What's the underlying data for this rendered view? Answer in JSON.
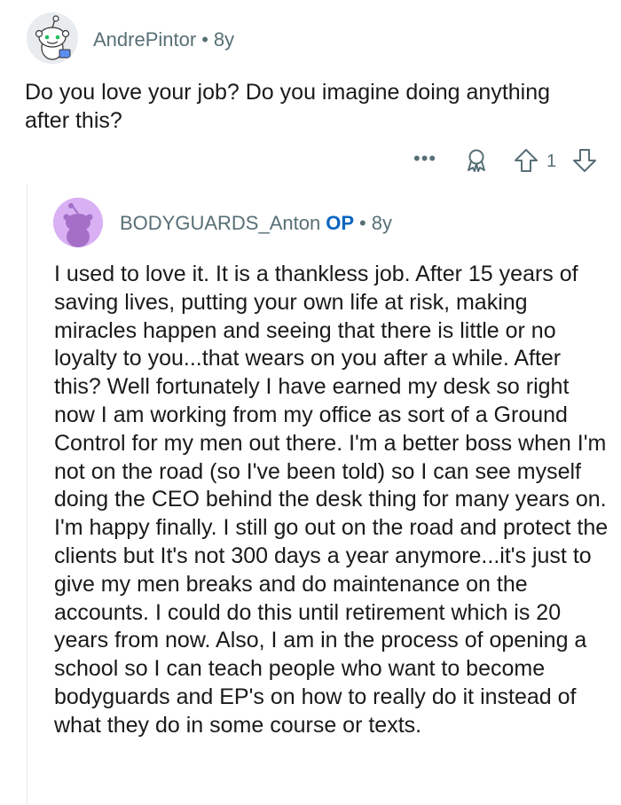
{
  "comment1": {
    "username": "AndrePintor",
    "separator": "•",
    "age": "8y",
    "text": "Do you love your job?  Do you imagine doing anything after this?",
    "actions": {
      "more_icon": "ellipsis-icon",
      "award_icon": "award-icon",
      "upvote_icon": "upvote-arrow-icon",
      "vote_count": "1",
      "downvote_icon": "downvote-arrow-icon"
    }
  },
  "comment2": {
    "username": "BODYGUARDS_Anton",
    "op_badge": "OP",
    "separator": "•",
    "age": "8y",
    "text": "I used to love it.  It is a thankless job.  After 15 years of saving lives, putting your own life at risk, making miracles happen and seeing that there is little or no loyalty to you...that wears on you after a while.  After this?  Well fortunately I have earned my desk so right now I am working from my office as sort of a Ground Control for my men out there.  I'm a better boss when I'm not on the road (so I've been told) so I can see myself doing the CEO behind the desk thing for many years on.  I'm happy finally.  I still go out on the road and protect the clients but It's not 300 days a year anymore...it's just to give my men breaks and do maintenance on the accounts.  I could do this until retirement which is 20 years from now.  Also, I am in the process of opening a school so I can teach people who want to become bodyguards and EP's on how to really do it instead of what they do in some course or texts."
  },
  "colors": {
    "meta_text": "#576f76",
    "body_text": "#1a1a1b",
    "op_badge": "#0a66c2",
    "avatar2_bg": "#d9b0f4"
  }
}
